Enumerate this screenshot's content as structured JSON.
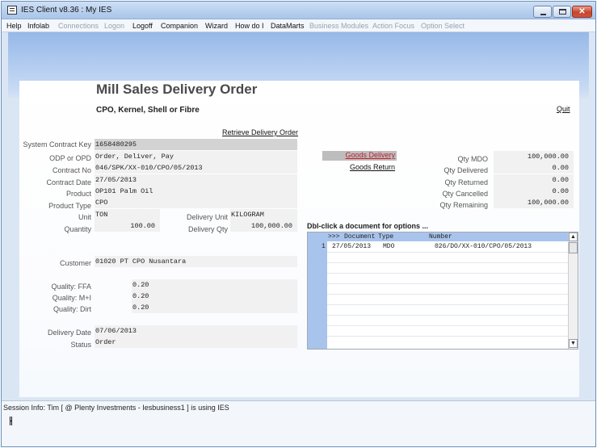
{
  "window": {
    "title": "IES Client v8.36 : My IES"
  },
  "menu": [
    {
      "label": "Help",
      "enabled": true
    },
    {
      "label": "Infolab",
      "enabled": true
    },
    {
      "label": "Connections",
      "enabled": false
    },
    {
      "label": "Logon",
      "enabled": false
    },
    {
      "label": "Logoff",
      "enabled": true
    },
    {
      "label": "Companion",
      "enabled": true
    },
    {
      "label": "Wizard",
      "enabled": true
    },
    {
      "label": "How do I",
      "enabled": true
    },
    {
      "label": "DataMarts",
      "enabled": true
    },
    {
      "label": "Business Modules",
      "enabled": false
    },
    {
      "label": "Action Focus",
      "enabled": false
    },
    {
      "label": "Option Select",
      "enabled": false
    }
  ],
  "page": {
    "title": "Mill Sales Delivery Order",
    "subtitle": "CPO, Kernel, Shell or Fibre",
    "quit_label": "Quit",
    "retrieve_label": "Retrieve Delivery Order"
  },
  "form": {
    "system_contract_key": {
      "label": "System Contract Key",
      "value": "1658480295"
    },
    "odp": {
      "label": "ODP or OPD",
      "value": "Order, Deliver, Pay"
    },
    "contract_no": {
      "label": "Contract No",
      "value": "046/SPK/XX-010/CPO/05/2013"
    },
    "contract_date": {
      "label": "Contract Date",
      "value": "27/05/2013"
    },
    "product": {
      "label": "Product",
      "value": "OP101 Palm Oil"
    },
    "product_type": {
      "label": "Product Type",
      "value": "CPO"
    },
    "unit": {
      "label": "Unit",
      "value": "TON"
    },
    "quantity": {
      "label": "Quantity",
      "value": "100.00"
    },
    "delivery_unit": {
      "label": "Delivery Unit",
      "value": "KILOGRAM"
    },
    "delivery_qty": {
      "label": "Delivery Qty",
      "value": "100,000.00"
    },
    "customer": {
      "label": "Customer",
      "value": "01020 PT CPO Nusantara"
    },
    "quality_ffa": {
      "label": "Quality: FFA",
      "value": "0.20"
    },
    "quality_mi": {
      "label": "Quality: M+I",
      "value": "0.20"
    },
    "quality_dirt": {
      "label": "Quality: Dirt",
      "value": "0.20"
    },
    "delivery_date": {
      "label": "Delivery Date",
      "value": "07/06/2013"
    },
    "status": {
      "label": "Status",
      "value": "Order"
    }
  },
  "actions": {
    "goods_delivery": "Goods Delivery",
    "goods_return": "Goods Return"
  },
  "qty": {
    "mdo": {
      "label": "Qty MDO",
      "value": "100,000.00"
    },
    "delivered": {
      "label": "Qty Delivered",
      "value": "0.00"
    },
    "returned": {
      "label": "Qty Returned",
      "value": "0.00"
    },
    "cancelled": {
      "label": "Qty Cancelled",
      "value": "0.00"
    },
    "remaining": {
      "label": "Qty Remaining",
      "value": "100,000.00"
    }
  },
  "documents": {
    "hint": "Dbl-click a document for options ...",
    "header_marker": ">>>",
    "columns": [
      "Document",
      "Type",
      "Number"
    ],
    "rows": [
      {
        "index": "1",
        "document": "27/05/2013",
        "type": "MDO",
        "number": "026/DO/XX-010/CPO/05/2013"
      }
    ]
  },
  "status_bar": {
    "session_info": "Session Info: Tim [ @ Plenty Investments   - Iesbusiness1 ] is using IES"
  },
  "icons": {
    "app": "app-window-icon",
    "minimize": "minimize-icon",
    "maximize": "maximize-icon",
    "close": "close-icon",
    "scroll_up": "scroll-up-arrow-icon",
    "scroll_down": "scroll-down-arrow-icon"
  },
  "colors": {
    "banner": "#97b8e8",
    "grid_header": "#a9c4ec",
    "goods_delivery_text": "#c0202a"
  }
}
